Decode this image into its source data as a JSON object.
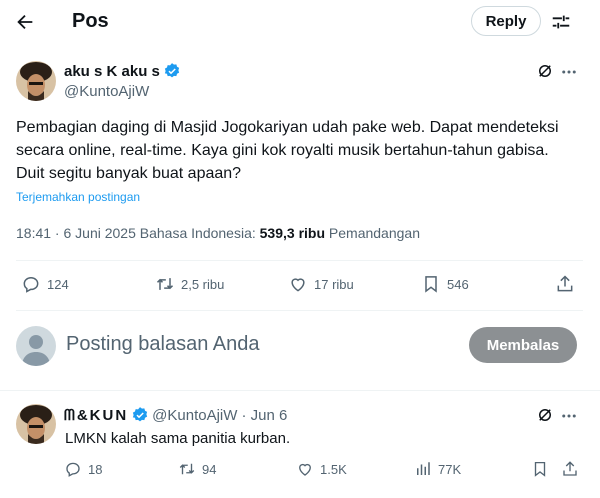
{
  "header": {
    "title": "Pos",
    "reply_label": "Reply"
  },
  "post": {
    "display_name": "aku s K aku s",
    "handle": "@KuntoAjiW",
    "text": "Pembagian daging di Masjid Jogokariyan udah pake web. Dapat mendeteksi secara online, real-time. Kaya gini kok royalti musik bertahun-tahun gabisa. Duit segitu banyak buat apaan?",
    "translate_label": "Terjemahkan postingan",
    "time": "18:41 · 6 Juni 2025",
    "language": "Bahasa Indonesia:",
    "views_count": "539,3 ribu",
    "views_label": "Pemandangan",
    "stats": {
      "replies": "124",
      "reposts": "2,5 ribu",
      "likes": "17 ribu",
      "bookmarks": "546"
    }
  },
  "compose": {
    "placeholder": "Posting balasan Anda",
    "submit_label": "Membalas"
  },
  "reply": {
    "display_name": "ᗰ&KUN",
    "handle": "@KuntoAjiW",
    "date": "· Jun 6",
    "text": "LMKN kalah sama panitia kurban.",
    "stats": {
      "replies": "18",
      "reposts": "94",
      "likes": "1.5K",
      "views": "77K"
    }
  },
  "colors": {
    "accent": "#1d9bf0",
    "muted": "#536471",
    "button_disabled": "#8c9093"
  },
  "icons": [
    "back-arrow-icon",
    "filter-icon",
    "verified-badge-icon",
    "grok-icon",
    "more-icon",
    "reply-icon",
    "repost-icon",
    "like-icon",
    "bookmark-icon",
    "share-icon",
    "views-icon",
    "default-avatar-icon"
  ]
}
